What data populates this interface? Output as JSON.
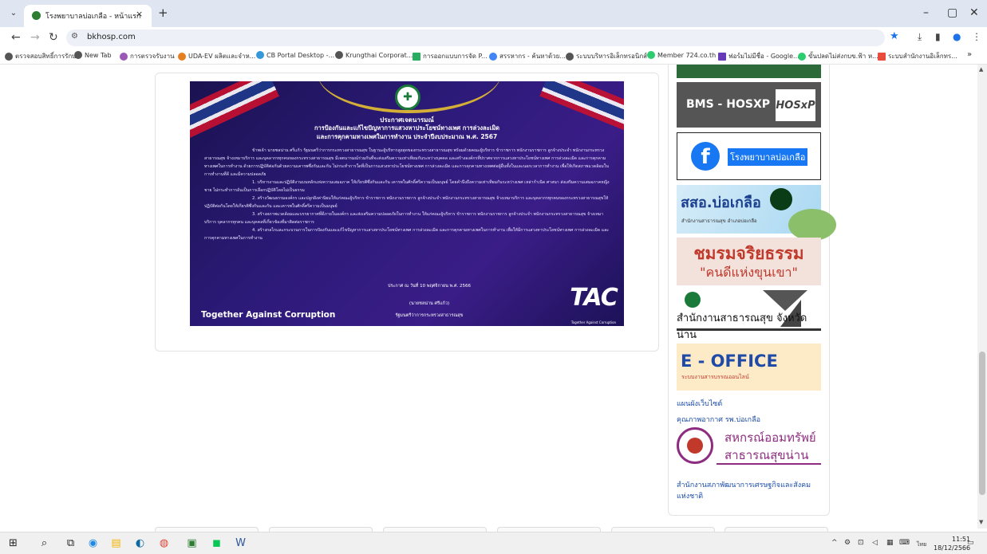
{
  "browser": {
    "tab_title": "โรงพยาบาลบ่อเกลือ - หน้าแรก",
    "tab_close": "×",
    "new_tab": "+",
    "url": "bkhosp.com",
    "window_controls": {
      "minimize": "–",
      "maximize": "▢",
      "close": "✕"
    }
  },
  "bookmarks": [
    {
      "label": "ตรวจสอบสิทธิ์การรักษา",
      "icon": "globe-icon",
      "color": "#555555"
    },
    {
      "label": "New Tab",
      "icon": "globe-icon",
      "color": "#555555"
    },
    {
      "label": "การตรวจรับงาน",
      "icon": "leaf-icon",
      "color": "#9b59b6"
    },
    {
      "label": "UDA-EV ผลิตและจำห...",
      "icon": "circle-icon",
      "color": "#e67e22"
    },
    {
      "label": "CB Portal Desktop -...",
      "icon": "cloud-icon",
      "color": "#3498db"
    },
    {
      "label": "Krungthai Corporat...",
      "icon": "globe-icon",
      "color": "#555555"
    },
    {
      "label": "การออกแบบการจัด P...",
      "icon": "doc-icon",
      "color": "#27ae60"
    },
    {
      "label": "สรรหากร - ค้นหาด้วย...",
      "icon": "google-icon",
      "color": "#4285f4"
    },
    {
      "label": "ระบบบริหารอิเล็กทรอนิกส์",
      "icon": "globe-icon",
      "color": "#555555"
    },
    {
      "label": "Member 724.co.th",
      "icon": "circle-icon",
      "color": "#2ecc71"
    },
    {
      "label": "ฟอร์มไม่มีชื่อ - Google...",
      "icon": "form-icon",
      "color": "#673ab7"
    },
    {
      "label": "ขั้นปลดไม่ส่งกบข.ฟ้า ห...",
      "icon": "circle-icon",
      "color": "#2ecc71"
    },
    {
      "label": "ระบบสำนักงานอิเล็กทร...",
      "icon": "flag-icon",
      "color": "#e74c3c"
    }
  ],
  "bookmarks_more": "»",
  "banner": {
    "heading1": "ประกาศเจตนารมณ์",
    "heading2": "การป้องกันและแก้ไขปัญหาการแสวงหาประโยชน์ทางเพศ การล่วงละเมิด",
    "heading3": "และการคุกคามทางเพศในการทำงาน ประจำปีงบประมาณ พ.ศ. 2567",
    "para1": "ข้าพเจ้า นายชลน่าน ศรีแก้ว รัฐมนตรีว่าการกระทรวงสาธารณสุข ในฐานะผู้บริหารสูงสุดของกระทรวงสาธารณสุข พร้อมด้วยคณะผู้บริหาร ข้าราชการ พนักงานราชการ ลูกจ้างประจำ พนักงานกระทรวงสาธารณสุข จ้างเหมาบริการ และบุคลากรทุกคนของกระทรวงสาธารณสุข มีเจตนารมณ์ร่วมกันที่จะส่งเสริมความเท่าเทียมกันระหว่างบุคคล และสร้างองค์กรที่ปราศจากการแสวงหาประโยชน์ทางเพศ การล่วงละเมิด และการคุกคามทางเพศในการทำงาน ด้วยการปฏิบัติต่อกันด้วยความเคารพซึ่งกันและกัน ไม่กระทำการใดที่เป็นการแสวงหาประโยชน์ทางเพศ การล่วงละเมิด และการคุกคามทางเพศต่อผู้อื่นทั้งในและนอกเวลาการทำงาน เพื่อให้เกิดสภาพแวดล้อมในการทำงานที่ดี และมีความปลอดภัย",
    "para2": "1. บริหารงานและปฏิบัติงานบนหลักแห่งความเสมอภาค ให้เกียรติซึ่งกันและกัน เคารพในศักดิ์ศรีความเป็นมนุษย์ โดยคำนึงถึงความเท่าเทียมกันระหว่างเพศ เหล่ากำเนิด ศาสนา ส่งเสริมความเสมอภาคหญิงชาย ไม่กระทำการอันเป็นการเลือกปฏิบัติโดยไม่เป็นธรรม",
    "para3": "2. สร้างวัฒนธรรมองค์กร และปลูกฝังค่านิยมให้แก่คณะผู้บริหาร ข้าราชการ พนักงานราชการ ลูกจ้างประจำ พนักงานกระทรวงสาธารณสุข จ้างเหมาบริการ และบุคลากรทุกคนของกระทรวงสาธารณสุขให้ปฏิบัติต่อกันโดยให้เกียรติซึ่งกันและกัน และเคารพในศักดิ์ศรีความเป็นมนุษย์",
    "para4": "3. สร้างสภาพแวดล้อมและบรรยากาศที่ดีภายในองค์กร และส่งเสริมความปลอดภัยในการทำงาน ให้แก่คณะผู้บริหาร ข้าราชการ พนักงานราชการ ลูกจ้างประจำ พนักงานกระทรวงสาธารณสุข จ้างเหมาบริการ บุคลากรทุกคน และบุคคลที่เกี่ยวข้องที่มาติดต่อราชการ",
    "para5": "4. สร้างกลไกและกระบวนการในการป้องกันและแก้ไขปัญหาการแสวงหาประโยชน์ทางเพศ การล่วงละเมิด และการคุกคามทางเพศในการทำงาน เพื่อให้มีการแสวงหาประโยชน์ทางเพศ การล่วงละเมิด และการคุกคามทางเพศในการทำงาน",
    "date": "ประกาศ ณ วันที่ 10 พฤศจิกายน พ.ศ. 2566",
    "signature": "(นายชลน่าน ศรีแก้ว)",
    "position": "รัฐมนตรีว่าการกระทรวงสาธารณสุข",
    "slogan": "Together Against Corruption",
    "tac": "TAC",
    "tac_sub": "Together Against Corruption"
  },
  "sidebar": {
    "bms_label": "BMS - HOSXP",
    "hosxp_label": "HOSxP",
    "facebook_label": "โรงพยาบาลบ่อเกลือ",
    "sso_title": "สสอ.บ่อเกลือ",
    "sso_sub": "สำนักงานสาธารณสุข อำเภอบ่อเกลือ",
    "club_title": "ชมรมจริยธรรม",
    "club_sub": "\"คนดีแห่งขุนเขา\"",
    "pho_title": "สำนักงานสาธารณสุข จังหวัดน่าน",
    "eoffice_title": "E - OFFICE",
    "eoffice_sub": "ระบบงานสารบรรณออนไลน์",
    "link_sitemap": "แผนผังเว็บไซต์",
    "link_weather": "คุณภาพอากาศ รพ.บ่อเกลือ",
    "coop_line1": "สหกรณ์ออมทรัพย์",
    "coop_line2": "สาธารณสุขน่าน",
    "link_nesdc": "สำนักงานสภาพัฒนาการเศรษฐกิจและสังคม แห่งชาติ"
  },
  "taskbar": {
    "language": "ไทย",
    "time": "11:51",
    "date": "18/12/2566"
  }
}
